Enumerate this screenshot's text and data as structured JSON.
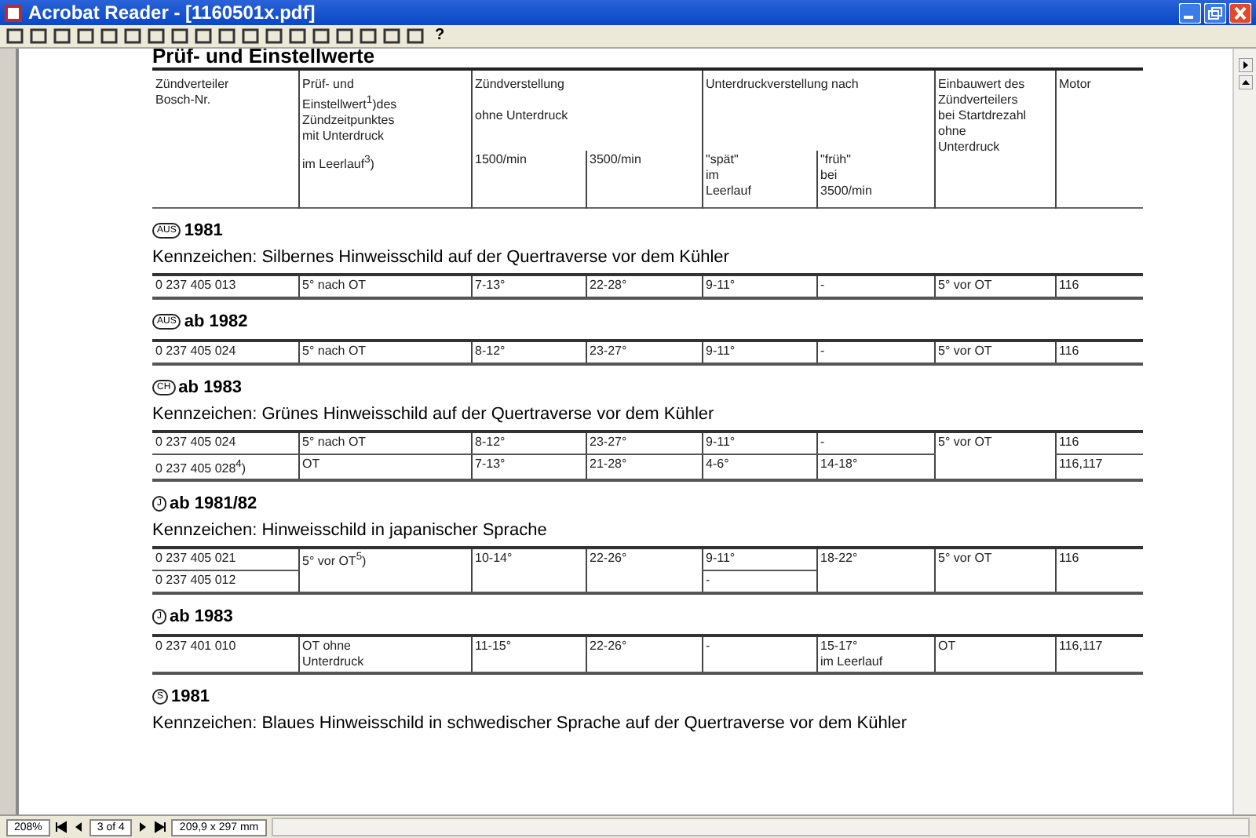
{
  "window": {
    "title": "Acrobat Reader - [1160501x.pdf]"
  },
  "toolbar": {
    "help": "?"
  },
  "page": {
    "title": "Prüf- und Einstellwerte",
    "header_rows": [
      [
        {
          "text": "Zündverteiler\nBosch-Nr.",
          "rowspan": 2
        },
        {
          "text": "Prüf- und\nEinstellwert$^{1}$)des\nZündzeitpunktes\nmit Unterdruck"
        },
        {
          "text": "Zündverstellung\n\nohne Unterdruck",
          "colspan": 2
        },
        {
          "text": "Unterdruckverstellung nach",
          "colspan": 2
        },
        {
          "text": "Einbauwert des\nZündverteilers\nbei Startdrezahl\nohne\nUnterdruck",
          "rowspan": 2
        },
        {
          "text": "Motor",
          "rowspan": 2
        }
      ],
      [
        {
          "text": "im Leerlauf$^{3}$)"
        },
        {
          "text": "1500/min"
        },
        {
          "text": "3500/min"
        },
        {
          "text": "\"spät\"\nim\nLeerlauf"
        },
        {
          "text": "\"früh\"\nbei\n3500/min"
        }
      ]
    ],
    "sections": [
      {
        "badge": "AUS",
        "heading": "1981",
        "note": "Kennzeichen: Silbernes Hinweisschild auf der Quertraverse vor dem Kühler",
        "rows": [
          [
            {
              "text": "0 237 405 013"
            },
            {
              "text": "5° nach OT"
            },
            {
              "text": "7-13°"
            },
            {
              "text": "22-28°"
            },
            {
              "text": "9-11°"
            },
            {
              "text": "-"
            },
            {
              "text": "5° vor OT"
            },
            {
              "text": "116"
            }
          ]
        ]
      },
      {
        "badge": "AUS",
        "heading": "ab 1982",
        "rows": [
          [
            {
              "text": "0 237 405 024"
            },
            {
              "text": "5° nach OT"
            },
            {
              "text": "8-12°"
            },
            {
              "text": "23-27°"
            },
            {
              "text": "9-11°"
            },
            {
              "text": "-"
            },
            {
              "text": "5° vor OT"
            },
            {
              "text": "116"
            }
          ]
        ]
      },
      {
        "badge": "CH",
        "heading": "ab 1983",
        "note": "Kennzeichen: Grünes Hinweisschild auf der Quertraverse vor dem Kühler",
        "rows": [
          [
            {
              "text": "0 237 405 024"
            },
            {
              "text": "5° nach OT"
            },
            {
              "text": "8-12°"
            },
            {
              "text": "23-27°"
            },
            {
              "text": "9-11°"
            },
            {
              "text": "-"
            },
            {
              "text": "5° vor OT",
              "rowspan": 2
            },
            {
              "text": "116"
            }
          ],
          [
            {
              "text": "0 237 405 028$^{4}$)"
            },
            {
              "text": "OT"
            },
            {
              "text": "7-13°"
            },
            {
              "text": "21-28°"
            },
            {
              "text": "4-6°"
            },
            {
              "text": "14-18°"
            },
            {
              "text": "116,117"
            }
          ]
        ]
      },
      {
        "badge": "J",
        "heading": "ab 1981/82",
        "note": "Kennzeichen: Hinweisschild in japanischer Sprache",
        "rows": [
          [
            {
              "text": "0 237 405 021"
            },
            {
              "text": "5° vor OT$^{5}$)",
              "rowspan": 2
            },
            {
              "text": "10-14°",
              "rowspan": 2
            },
            {
              "text": "22-26°",
              "rowspan": 2
            },
            {
              "text": "9-11°"
            },
            {
              "text": "18-22°",
              "rowspan": 2
            },
            {
              "text": "5° vor OT",
              "rowspan": 2
            },
            {
              "text": "116",
              "rowspan": 2
            }
          ],
          [
            {
              "text": "0 237 405 012"
            },
            {
              "text": "-"
            }
          ]
        ]
      },
      {
        "badge": "J",
        "heading": "ab 1983",
        "rows": [
          [
            {
              "text": "0 237 401 010"
            },
            {
              "text": "OT ohne\nUnterdruck"
            },
            {
              "text": "11-15°"
            },
            {
              "text": "22-26°"
            },
            {
              "text": "-"
            },
            {
              "text": "15-17°\nim Leerlauf"
            },
            {
              "text": "OT"
            },
            {
              "text": "116,117"
            }
          ]
        ]
      },
      {
        "badge": "S",
        "heading": "1981",
        "note": "Kennzeichen: Blaues Hinweisschild in schwedischer Sprache auf der Quertraverse vor dem Kühler"
      }
    ]
  },
  "status_bar": {
    "zoom": "208%",
    "page": "3 of 4",
    "size": "209,9 x 297 mm"
  }
}
